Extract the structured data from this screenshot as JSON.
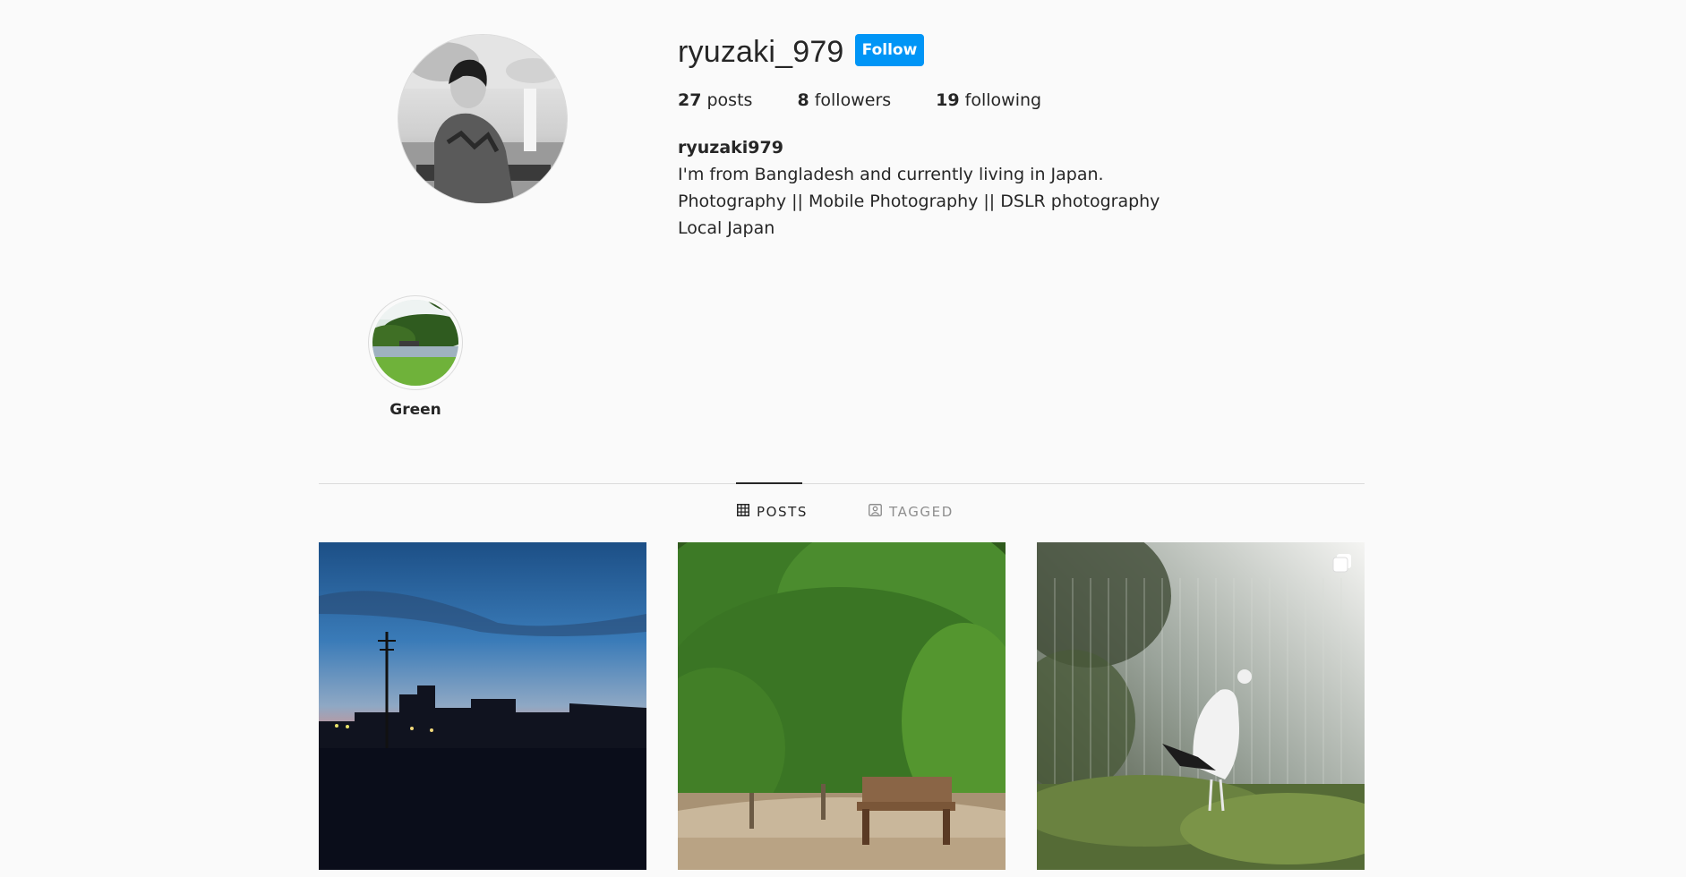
{
  "profile": {
    "username": "ryuzaki_979",
    "follow_label": "Follow",
    "stats": {
      "posts_count": "27",
      "posts_label": "posts",
      "followers_count": "8",
      "followers_label": "followers",
      "following_count": "19",
      "following_label": "following"
    },
    "bio": {
      "name": "ryuzaki979",
      "line1": "I'm from Bangladesh and currently living in Japan.",
      "line2": "Photography || Mobile Photography || DSLR photography",
      "line3": "Local Japan"
    }
  },
  "highlights": [
    {
      "label": "Green"
    }
  ],
  "tabs": {
    "posts": "POSTS",
    "tagged": "TAGGED"
  },
  "colors": {
    "accent": "#0095f6",
    "text": "#262626",
    "muted": "#8e8e8e",
    "border": "#dbdbdb",
    "background": "#fafafa"
  },
  "icons": {
    "posts_tab": "grid-icon",
    "tagged_tab": "tagged-user-icon",
    "multi_post": "carousel-icon"
  }
}
